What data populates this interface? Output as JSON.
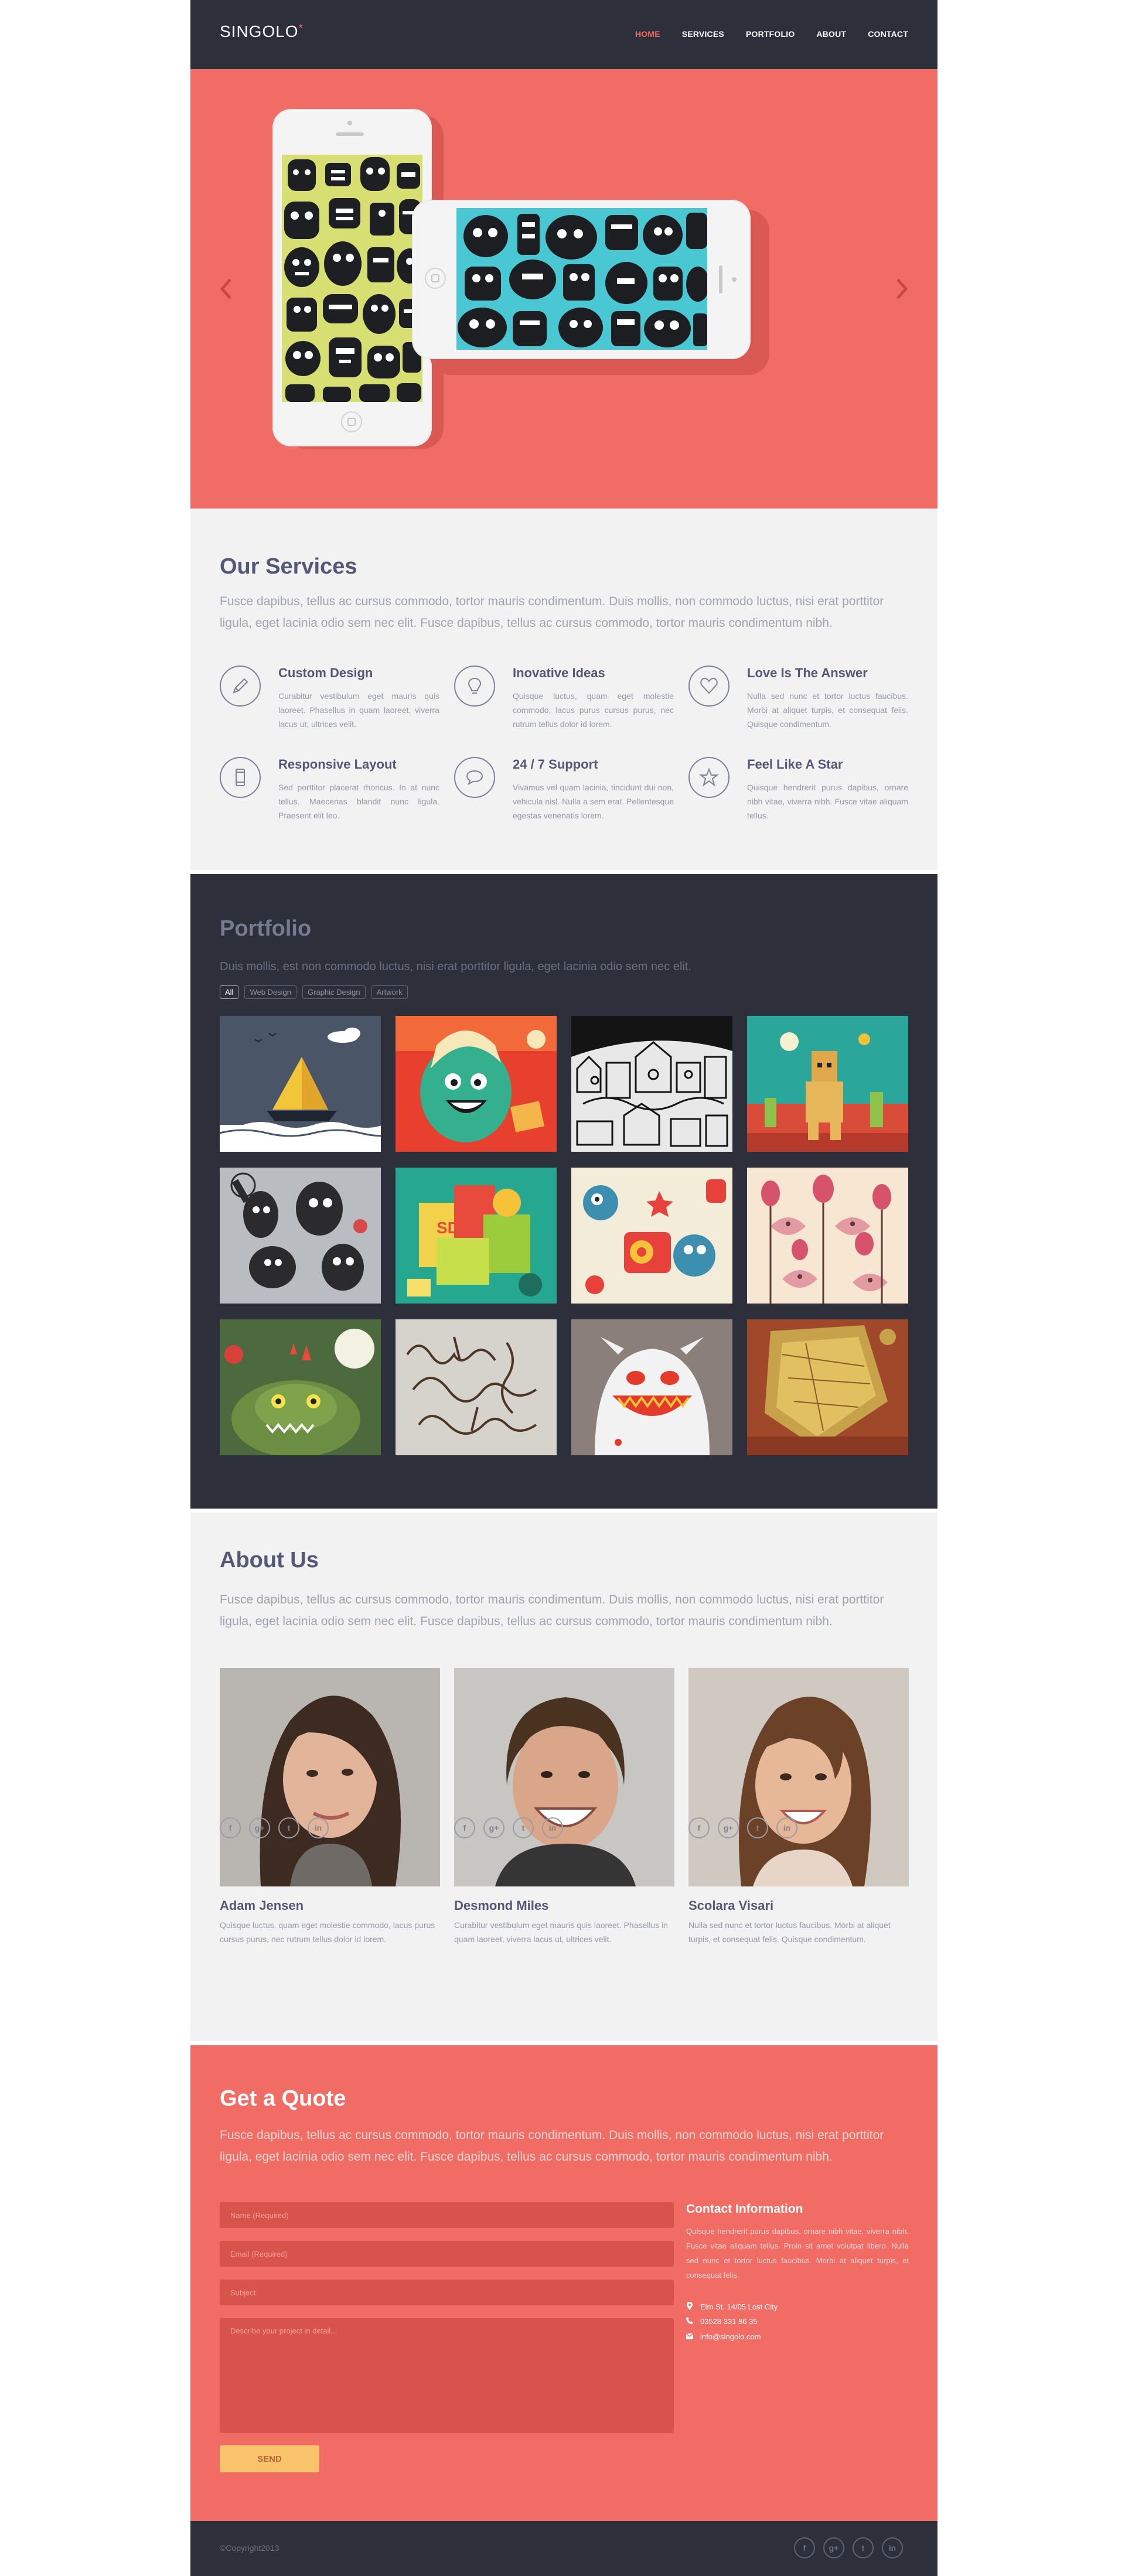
{
  "header": {
    "logo": "SINGOLO",
    "logo_mark": "*",
    "nav": [
      "HOME",
      "SERVICES",
      "PORTFOLIO",
      "ABOUT",
      "CONTACT"
    ]
  },
  "slider": {
    "prev_icon": "chevron-left-icon",
    "next_icon": "chevron-right-icon"
  },
  "services": {
    "title": "Our Services",
    "text": "Fusce dapibus, tellus ac cursus commodo, tortor mauris condimentum. Duis mollis, non commodo luctus, nisi erat porttitor ligula, eget lacinia odio sem nec elit. Fusce dapibus, tellus ac cursus commodo, tortor mauris condimentum nibh.",
    "items": [
      {
        "title": "Custom Design",
        "icon": "pencil-icon",
        "text": "Curabitur vestibulum eget mauris quis laoreet. Phasellus in quam laoreet, viverra lacus ut, ultrices velit."
      },
      {
        "title": "Inovative Ideas",
        "icon": "lightbulb-icon",
        "text": "Quisque luctus, quam eget molestie commodo, lacus purus cursus purus, nec rutrum tellus dolor id lorem."
      },
      {
        "title": "Love Is The Answer",
        "icon": "heart-icon",
        "text": "Nulla sed nunc et tortor luctus faucibus. Morbi at aliquet turpis, et consequat felis. Quisque condimentum."
      },
      {
        "title": "Responsive Layout",
        "icon": "mobile-icon",
        "text": "Sed porttitor placerat rhoncus. In at nunc tellus. Maecenas blandit nunc ligula. Praesent elit leo."
      },
      {
        "title": "24 / 7 Support",
        "icon": "chat-icon",
        "text": "Vivamus vel quam lacinia, tincidunt dui non, vehicula nisl. Nulla a sem erat. Pellentesque egestas venenatis lorem."
      },
      {
        "title": "Feel Like A Star",
        "icon": "star-icon",
        "text": "Quisque hendrerit purus dapibus, ornare nibh vitae, viverra nibh. Fusce vitae aliquam tellus."
      }
    ]
  },
  "portfolio": {
    "title": "Portfolio",
    "text": "Duis mollis, est non commodo luctus, nisi erat porttitor ligula, eget lacinia odio sem nec elit.",
    "filters": [
      "All",
      "Web Design",
      "Graphic Design",
      "Artwork"
    ]
  },
  "about": {
    "title": "About Us",
    "text": "Fusce dapibus, tellus ac cursus commodo, tortor mauris condimentum. Duis mollis, non commodo luctus, nisi erat porttitor ligula, eget lacinia odio sem nec elit. Fusce dapibus, tellus ac cursus commodo, tortor mauris condimentum nibh.",
    "members": [
      {
        "name": "Adam Jensen",
        "text": "Quisque luctus, quam eget molestie commodo, lacus purus cursus purus, nec rutrum tellus dolor id lorem."
      },
      {
        "name": "Desmond Miles",
        "text": "Curabitur vestibulum eget mauris quis laoreet. Phasellus in quam laoreet, viverra lacus ut, ultrices velit."
      },
      {
        "name": "Scolara Visari",
        "text": "Nulla sed nunc et tortor luctus faucibus. Morbi at aliquet turpis, et consequat felis. Quisque condimentum."
      }
    ],
    "social": [
      "f",
      "g+",
      "t",
      "in"
    ]
  },
  "quote": {
    "title": "Get a Quote",
    "text": "Fusce dapibus, tellus ac cursus commodo, tortor mauris condimentum. Duis mollis, non commodo luctus, nisi erat porttitor ligula, eget lacinia odio sem nec elit. Fusce dapibus, tellus ac cursus commodo, tortor mauris condimentum nibh.",
    "name_placeholder": "Name (Required)",
    "email_placeholder": "Email (Required)",
    "subject_placeholder": "Subject",
    "message_placeholder": "Describe your project in detail...",
    "send_label": "SEND",
    "contact_title": "Contact Information",
    "contact_text": "Quisque hendrerit purus dapibus, ornare nibh vitae, viverra nibh. Fusce vitae aliquam tellus. Proin sit amet volutpat libero. Nulla sed nunc et tortor luctus faucibus. Morbi at aliquet turpis, et consequat felis.",
    "address": "Elm St. 14/05 Lost City",
    "phone": "03528 331 86 35",
    "email": "info@singolo.com"
  },
  "footer": {
    "copyright": "©Copyright2013"
  },
  "colors": {
    "accent": "#f06c64",
    "dark": "#2d303a",
    "light": "#f2f2f2",
    "button": "#f8c36b"
  }
}
